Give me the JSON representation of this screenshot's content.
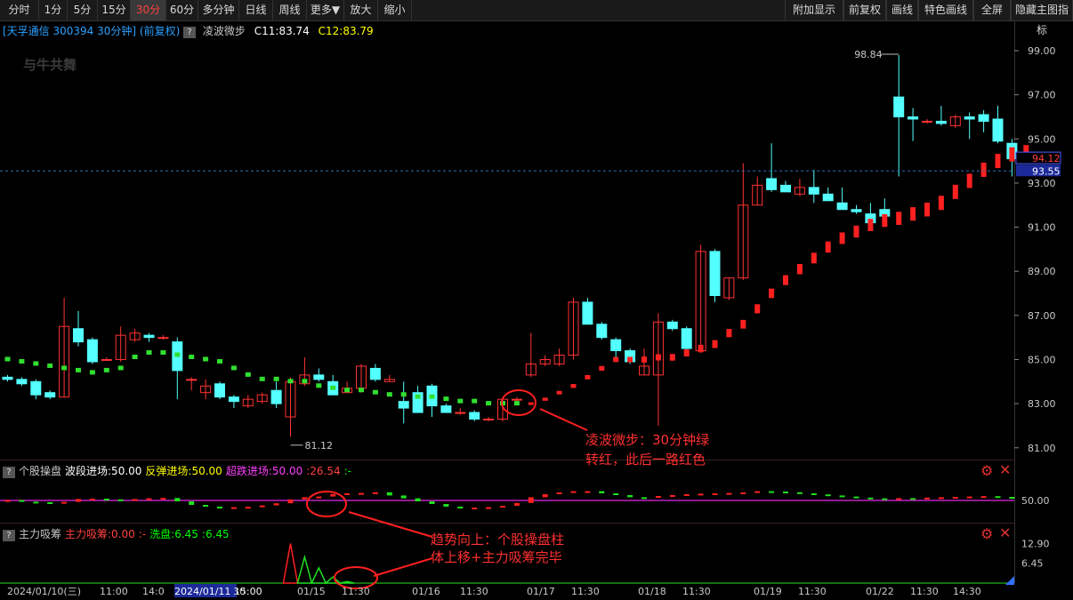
{
  "toolbar": {
    "left": [
      "分时",
      "1分",
      "5分",
      "15分",
      "30分",
      "60分",
      "多分钟",
      "日线",
      "周线",
      "更多▼",
      "放大",
      "缩小"
    ],
    "active_index": 4,
    "right": [
      "附加显示",
      "前复权",
      "画线",
      "特色画线",
      "全屏",
      "隐藏主图指标"
    ]
  },
  "main": {
    "title_text": "[天孚通信 300394 30分钟] (前复权)",
    "indicator_name": "凌波微步",
    "c11": "C11:83.74",
    "c12": "C12:83.79",
    "watermark": "与牛共舞",
    "high_label": "98.84",
    "low_label": "81.12",
    "y_ticks": [
      "99.00",
      "97.00",
      "95.00",
      "93.00",
      "91.00",
      "89.00",
      "87.00",
      "85.00",
      "83.00",
      "81.00"
    ],
    "cur_price": "94.12",
    "dash_price": "93.55",
    "annotation_lines": [
      "凌波微步：30分钟绿",
      "转红，此后一路红色"
    ]
  },
  "panel2": {
    "name": "个股操盘",
    "items": [
      {
        "text": "波段进场:50.00",
        "color": "#ffffff"
      },
      {
        "text": "反弹进场:50.00",
        "color": "#ffff00"
      },
      {
        "text": "超跌进场:50.00",
        "color": "#ff40ff"
      },
      {
        "text": ":26.54",
        "color": "#ff4040"
      },
      {
        "text": ":-",
        "color": "#00ff00"
      }
    ],
    "y_tick": "50.00"
  },
  "panel3": {
    "name": "主力吸筹",
    "items": [
      {
        "text": "主力吸筹:0.00",
        "color": "#ff4040"
      },
      {
        "text": ":-",
        "color": "#ff4040"
      },
      {
        "text": "洗盘:6.45",
        "color": "#00ff00"
      },
      {
        "text": ":6.45",
        "color": "#00ff00"
      }
    ],
    "y_ticks": [
      "12.90",
      "6.45"
    ],
    "annotation_lines": [
      "趋势向上：个股操盘柱",
      "体上移+主力吸筹完毕"
    ]
  },
  "xaxis": {
    "labels": [
      "2024/01/10(三)",
      "11:00",
      "14:0",
      "2024/01/11 15:00",
      "30",
      "01/15",
      "11:30",
      "01/16",
      "11:30",
      "01/17",
      "11:30",
      "01/18",
      "11:30",
      "01/19",
      "11:30",
      "01/22",
      "11:30",
      "14:30"
    ]
  },
  "colors": {
    "up": "#ff3232",
    "down": "#54ffff",
    "bg": "#000000",
    "accent": "#ff4040",
    "green": "#00ff00",
    "purple": "#ff00ff"
  },
  "chart_data": {
    "type": "candlestick",
    "ylim": [
      80.3,
      100.0
    ],
    "candles": [
      [
        84.2,
        84.3,
        84.0,
        84.1
      ],
      [
        84.1,
        84.2,
        83.8,
        83.9
      ],
      [
        84.0,
        84.1,
        83.2,
        83.4
      ],
      [
        83.5,
        83.6,
        83.2,
        83.3
      ],
      [
        83.3,
        87.8,
        83.3,
        86.5
      ],
      [
        86.4,
        87.2,
        85.6,
        85.8
      ],
      [
        85.9,
        86.0,
        84.8,
        84.9
      ],
      [
        85.0,
        85.1,
        85.0,
        85.0
      ],
      [
        85.0,
        86.5,
        84.9,
        86.1
      ],
      [
        85.9,
        86.4,
        85.8,
        86.2
      ],
      [
        86.1,
        86.2,
        85.8,
        86.0
      ],
      [
        86.0,
        86.1,
        85.9,
        86.0
      ],
      [
        85.8,
        86.0,
        83.2,
        84.5
      ],
      [
        84.1,
        84.2,
        83.6,
        84.1
      ],
      [
        83.5,
        84.1,
        83.2,
        83.8
      ],
      [
        83.9,
        84.0,
        83.2,
        83.3
      ],
      [
        83.3,
        83.4,
        82.8,
        83.1
      ],
      [
        82.9,
        83.4,
        82.8,
        83.2
      ],
      [
        83.1,
        83.5,
        83.0,
        83.4
      ],
      [
        83.6,
        84.0,
        82.8,
        83.0
      ],
      [
        82.4,
        84.2,
        81.5,
        84.0
      ],
      [
        83.9,
        85.1,
        83.8,
        84.3
      ],
      [
        84.3,
        84.6,
        84.0,
        84.1
      ],
      [
        84.0,
        84.3,
        83.4,
        83.4
      ],
      [
        83.5,
        84.0,
        83.5,
        83.7
      ],
      [
        83.7,
        84.8,
        83.5,
        84.7
      ],
      [
        84.6,
        84.8,
        84.0,
        84.1
      ],
      [
        84.0,
        84.3,
        84.0,
        84.1
      ],
      [
        83.1,
        84.0,
        82.1,
        82.8
      ],
      [
        83.5,
        83.8,
        82.7,
        82.6
      ],
      [
        83.8,
        83.9,
        82.4,
        82.9
      ],
      [
        82.9,
        83.0,
        82.6,
        82.6
      ],
      [
        82.6,
        82.8,
        82.5,
        82.6
      ],
      [
        82.6,
        82.7,
        82.2,
        82.3
      ],
      [
        82.3,
        82.4,
        82.2,
        82.3
      ],
      [
        82.3,
        83.3,
        82.2,
        83.2
      ],
      [
        83.2,
        83.3,
        83.1,
        83.2
      ],
      [
        84.3,
        86.2,
        84.2,
        84.8
      ],
      [
        84.8,
        85.2,
        84.7,
        85.0
      ],
      [
        84.8,
        85.5,
        84.7,
        85.2
      ],
      [
        85.2,
        87.8,
        85.0,
        87.6
      ],
      [
        87.6,
        87.8,
        86.6,
        86.6
      ],
      [
        86.6,
        86.7,
        85.9,
        86.0
      ],
      [
        85.9,
        86.0,
        85.1,
        85.4
      ],
      [
        85.4,
        85.5,
        84.8,
        84.9
      ],
      [
        84.3,
        85.5,
        84.3,
        84.7
      ],
      [
        84.3,
        87.1,
        82.0,
        86.7
      ],
      [
        86.7,
        86.8,
        86.3,
        86.4
      ],
      [
        86.4,
        86.5,
        85.4,
        85.5
      ],
      [
        85.4,
        90.2,
        85.3,
        89.9
      ],
      [
        89.9,
        90.0,
        87.6,
        87.9
      ],
      [
        87.8,
        88.7,
        87.7,
        88.7
      ],
      [
        88.7,
        93.9,
        88.6,
        92.0
      ],
      [
        92.0,
        93.3,
        92.0,
        92.9
      ],
      [
        93.2,
        94.8,
        92.6,
        92.7
      ],
      [
        92.9,
        93.1,
        92.6,
        92.6
      ],
      [
        92.5,
        93.2,
        92.4,
        92.8
      ],
      [
        92.8,
        93.6,
        92.1,
        92.5
      ],
      [
        92.5,
        92.8,
        92.2,
        92.2
      ],
      [
        92.1,
        92.8,
        91.8,
        91.8
      ],
      [
        91.8,
        92.0,
        91.6,
        91.7
      ],
      [
        91.6,
        92.1,
        91.5,
        91.2
      ],
      [
        91.8,
        92.3,
        91.5,
        91.5
      ],
      [
        96.9,
        98.8,
        93.3,
        96.0
      ],
      [
        96.0,
        96.4,
        94.9,
        95.9
      ],
      [
        95.8,
        95.9,
        95.7,
        95.8
      ],
      [
        95.8,
        96.5,
        95.6,
        95.7
      ],
      [
        95.6,
        96.1,
        95.5,
        96.0
      ],
      [
        96.0,
        96.2,
        95.0,
        95.9
      ],
      [
        96.1,
        96.3,
        95.3,
        95.8
      ],
      [
        95.9,
        96.5,
        94.8,
        94.9
      ],
      [
        94.8,
        95.0,
        93.3,
        94.1
      ]
    ],
    "ribbon_green": [
      85.0,
      84.9,
      84.8,
      84.7,
      84.6,
      84.5,
      84.4,
      84.5,
      84.6,
      85.1,
      85.3,
      85.3,
      85.2,
      85.1,
      85.0,
      84.9,
      84.6,
      84.3,
      84.1,
      84.1,
      84.0,
      84.0,
      83.8,
      83.7,
      83.6,
      83.6,
      83.5,
      83.4,
      83.4,
      83.3,
      83.3,
      83.2,
      83.1,
      83.1,
      83.0,
      83.0,
      83.0
    ],
    "ribbon_red_start": 37,
    "ribbon_red": [
      83.0,
      83.2,
      83.5,
      83.8,
      84.2,
      84.6,
      85.0,
      85.0,
      85.0,
      85.1,
      85.1,
      85.3,
      85.5,
      85.7,
      86.2,
      86.6,
      87.3,
      88.0,
      88.6,
      89.1,
      89.6,
      90.1,
      90.5,
      90.8,
      91.1,
      91.3,
      91.4,
      91.6,
      91.8,
      92.1,
      92.6,
      93.1,
      93.6,
      94.0,
      94.3,
      94.4
    ],
    "high_marker": 98.84,
    "low_marker": 81.12,
    "cur_price": 94.12,
    "dash_price": 93.55,
    "panel2_values": [
      50.2,
      49.3,
      49.0,
      48.6,
      49.2,
      50.8,
      51.0,
      50.6,
      50.4,
      50.8,
      51.2,
      51.4,
      49.5,
      47.5,
      46.5,
      46.2,
      46.2,
      46.4,
      47.2,
      48.4,
      50.6,
      51.8,
      52.2,
      53.6,
      54.0,
      54.2,
      54.6,
      52.8,
      51.2,
      49.5,
      48.0,
      46.5,
      46.0,
      46.0,
      46.2,
      47.0,
      48.6,
      51.8,
      53.5,
      54.5,
      55.2,
      55.2,
      54.0,
      53.0,
      51.8,
      51.5,
      52.5,
      53.0,
      53.5,
      53.8,
      54.0,
      54.2,
      54.5,
      55.2,
      55.0,
      54.6,
      54.0,
      53.4,
      52.8,
      52.2,
      51.6,
      51.2,
      51.0,
      51.3,
      51.2,
      51.6,
      51.8,
      52.0,
      52.2,
      52.4,
      52.0,
      51.2
    ],
    "panel3_values": [
      0,
      0,
      0,
      0,
      0,
      0,
      0,
      0,
      0,
      0,
      0,
      0,
      0,
      0,
      0,
      0,
      0,
      0,
      0,
      0,
      12.9,
      8.5,
      5.0,
      2.0,
      0.5,
      0,
      0,
      0,
      0,
      0,
      0,
      0,
      0,
      0,
      0,
      0,
      0,
      0,
      0,
      0,
      0,
      0,
      0,
      0,
      0,
      0,
      0,
      0,
      0,
      0,
      0,
      0,
      0,
      0,
      0,
      0,
      0,
      0,
      0,
      0,
      0,
      0,
      0,
      0,
      0,
      0,
      0,
      0,
      0,
      0,
      0,
      0
    ]
  }
}
